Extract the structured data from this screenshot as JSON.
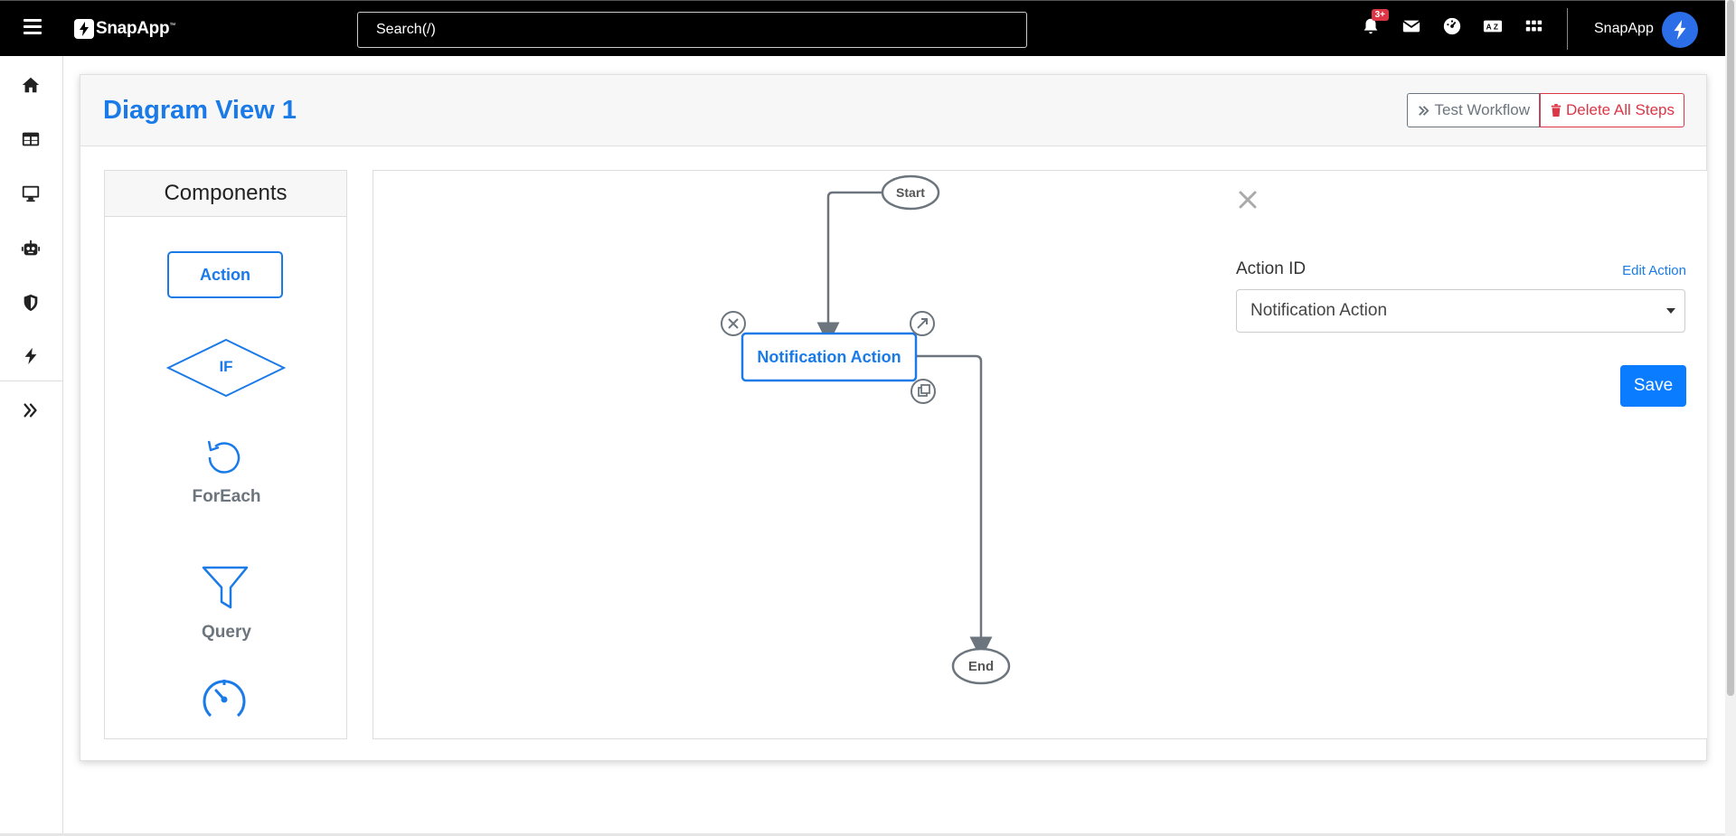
{
  "brand": {
    "name": "SnapApp",
    "tm": "™"
  },
  "search": {
    "placeholder": "Search(/)"
  },
  "notifications": {
    "badge": "3+"
  },
  "user": {
    "name": "SnapApp"
  },
  "sidebar": {
    "items": [
      {
        "icon": "home-icon"
      },
      {
        "icon": "table-icon"
      },
      {
        "icon": "monitor-icon"
      },
      {
        "icon": "robot-icon"
      },
      {
        "icon": "shield-icon"
      },
      {
        "icon": "bolt-icon"
      },
      {
        "icon": "double-chevron-right-icon"
      }
    ]
  },
  "page": {
    "title": "Diagram View 1"
  },
  "toolbar": {
    "test_label": "Test Workflow",
    "delete_label": "Delete All Steps"
  },
  "components": {
    "title": "Components",
    "action_label": "Action",
    "if_label": "IF",
    "foreach_label": "ForEach",
    "query_label": "Query"
  },
  "diagram": {
    "start_label": "Start",
    "node_label": "Notification Action",
    "end_label": "End"
  },
  "properties": {
    "field_label": "Action ID",
    "edit_link": "Edit Action",
    "selected_value": "Notification Action",
    "save_label": "Save"
  },
  "colors": {
    "accent": "#1a7ae8",
    "danger": "#dc3545",
    "muted": "#6c757d",
    "topbar": "#000000"
  }
}
